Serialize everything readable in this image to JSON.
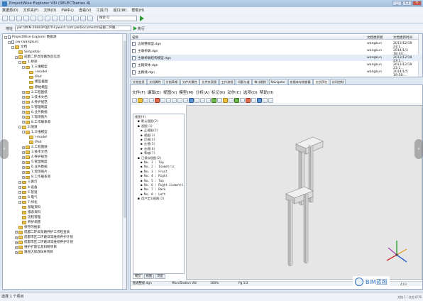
{
  "window": {
    "title": "ProjectWise Explorer V8i (SELECTseries 4)"
  },
  "menu": [
    "数据源(D)",
    "文件夹(F)",
    "文档(D)",
    "PW中心",
    "查看(V)",
    "工具(T)",
    "窗口(W)",
    "帮助(H)"
  ],
  "toolbar": {
    "search_value": "搜索 Q"
  },
  "address": {
    "label": "地址",
    "value": "pw:\\\\WIN-20883PQJOTH.pwsr4.com:pw\\Documents\\成都二环路...",
    "go_label": "执行"
  },
  "tree": [
    {
      "indent": 0,
      "exp": "-",
      "icon": "doc",
      "label": "ProjectWise Explorer 数据源"
    },
    {
      "indent": 1,
      "exp": "-",
      "icon": "doc",
      "label": "pw (wangkun)"
    },
    {
      "indent": 2,
      "exp": "-",
      "icon": "folder",
      "label": "文档"
    },
    {
      "indent": 3,
      "exp": "",
      "icon": "folder",
      "label": "Simplefair"
    },
    {
      "indent": 3,
      "exp": "-",
      "icon": "folder",
      "label": "成都二环高架路改造信息"
    },
    {
      "indent": 4,
      "exp": "-",
      "icon": "folder",
      "label": "1.桥梁"
    },
    {
      "indent": 5,
      "exp": "-",
      "icon": "folder",
      "label": "1.三维模型"
    },
    {
      "indent": 6,
      "exp": "",
      "icon": "folder",
      "label": "i-model"
    },
    {
      "indent": 6,
      "exp": "",
      "icon": "folder",
      "label": "iPad"
    },
    {
      "indent": 6,
      "exp": "",
      "icon": "folder",
      "label": "模型截图"
    },
    {
      "indent": 6,
      "exp": "",
      "icon": "folder",
      "label": "原始模型"
    },
    {
      "indent": 5,
      "exp": "+",
      "icon": "folder",
      "label": "2.工程图纸"
    },
    {
      "indent": 5,
      "exp": "+",
      "icon": "folder",
      "label": "3.技术文档"
    },
    {
      "indent": 5,
      "exp": "+",
      "icon": "folder",
      "label": "4.养护规范"
    },
    {
      "indent": 5,
      "exp": "+",
      "icon": "folder",
      "label": "5.管理制度"
    },
    {
      "indent": 5,
      "exp": "+",
      "icon": "folder",
      "label": "6.业务数据"
    },
    {
      "indent": 5,
      "exp": "+",
      "icon": "folder",
      "label": "7.现场照片"
    },
    {
      "indent": 5,
      "exp": "+",
      "icon": "folder",
      "label": "8.工作联系单"
    },
    {
      "indent": 4,
      "exp": "-",
      "icon": "folder",
      "label": "2.隧道"
    },
    {
      "indent": 5,
      "exp": "-",
      "icon": "folder",
      "label": "1.三维模型"
    },
    {
      "indent": 6,
      "exp": "",
      "icon": "folder",
      "label": "i-model"
    },
    {
      "indent": 6,
      "exp": "",
      "icon": "folder",
      "label": "iPad"
    },
    {
      "indent": 5,
      "exp": "+",
      "icon": "folder",
      "label": "2.工程图纸"
    },
    {
      "indent": 5,
      "exp": "+",
      "icon": "folder",
      "label": "3.技术文档"
    },
    {
      "indent": 5,
      "exp": "+",
      "icon": "folder",
      "label": "4.养护规范"
    },
    {
      "indent": 5,
      "exp": "+",
      "icon": "folder",
      "label": "5.管理制度"
    },
    {
      "indent": 5,
      "exp": "+",
      "icon": "folder",
      "label": "6.业务数据"
    },
    {
      "indent": 5,
      "exp": "+",
      "icon": "folder",
      "label": "7.现场照片"
    },
    {
      "indent": 5,
      "exp": "+",
      "icon": "folder",
      "label": "8.工作联系单"
    },
    {
      "indent": 4,
      "exp": "+",
      "icon": "folder",
      "label": "3.路灯"
    },
    {
      "indent": 4,
      "exp": "+",
      "icon": "folder",
      "label": "4.设备"
    },
    {
      "indent": 4,
      "exp": "+",
      "icon": "folder",
      "label": "5.管道"
    },
    {
      "indent": 4,
      "exp": "+",
      "icon": "folder",
      "label": "6.电气"
    },
    {
      "indent": 4,
      "exp": "+",
      "icon": "folder",
      "label": "7.绿化"
    },
    {
      "indent": 4,
      "exp": "",
      "icon": "folder",
      "label": "基础资料"
    },
    {
      "indent": 4,
      "exp": "",
      "icon": "folder",
      "label": "报表资料"
    },
    {
      "indent": 4,
      "exp": "",
      "icon": "folder",
      "label": "流程管理"
    },
    {
      "indent": 4,
      "exp": "",
      "icon": "folder",
      "label": "养护病害"
    },
    {
      "indent": 3,
      "exp": "",
      "icon": "folder",
      "label": "保存的搜索"
    },
    {
      "indent": 3,
      "exp": "+",
      "icon": "folder",
      "label": "成都二环高架路养护工作检查表"
    },
    {
      "indent": 3,
      "exp": "+",
      "icon": "folder",
      "label": "成都市区二环路日常维修养护计划"
    },
    {
      "indent": 3,
      "exp": "+",
      "icon": "folder",
      "label": "成都市区二环路日常维修养护计划"
    },
    {
      "indent": 3,
      "exp": "+",
      "icon": "folder",
      "label": "维护扩建信息科研项目"
    },
    {
      "indent": 3,
      "exp": "+",
      "icon": "folder",
      "label": "隧道大修改BIM项目"
    }
  ],
  "filelist": {
    "headers": [
      "名称",
      "文档更新者",
      "文档更新时间"
    ],
    "rows": [
      {
        "name": "边坡整模型.dgn",
        "user": "wangkun",
        "time": "2013/12/19 23:1..."
      },
      {
        "name": "主墩桥墩.dgn",
        "user": "wangkun",
        "time": "2014/1/3 18:44:..."
      },
      {
        "name": "主墩桥墩结构模型.dgn",
        "user": "wangkun",
        "time": "2013/12/19 23:1...",
        "selected": true
      },
      {
        "name": "主箱梁体.dgn",
        "user": "wangkun",
        "time": "2013/12/19 23:1..."
      },
      {
        "name": "主路线.dgn",
        "user": "wangkun",
        "time": "2014/1/5 19:58:..."
      }
    ]
  },
  "tabs": [
    "文档信息",
    "文档属性",
    "文档表格",
    "文件夹属性",
    "文件夹表格",
    "工作流程",
    "问题与道",
    "审计跟踪",
    "Navigator",
    "各版本存储查看",
    "文档预览",
    "访问控制"
  ],
  "active_tab_index": 10,
  "viewer": {
    "menu": [
      "文件(F)",
      "编辑(E)",
      "视图(V)",
      "模型(M)",
      "分析(A)",
      "标记(K)",
      "动作(C)",
      "选项(O)",
      "帮助(H)"
    ],
    "model_tree": [
      {
        "indent": 0,
        "label": "视图(V)"
      },
      {
        "indent": 1,
        "label": "■ 默认视图(2)"
      },
      {
        "indent": 1,
        "label": "■ 视图(1)"
      },
      {
        "indent": 2,
        "label": "● 正视图(2)"
      },
      {
        "indent": 2,
        "label": "● 视图(3)"
      },
      {
        "indent": 2,
        "label": "● 后视(4)"
      },
      {
        "indent": 2,
        "label": "● 左视(5)"
      },
      {
        "indent": 2,
        "label": "● 右视(6)"
      },
      {
        "indent": 2,
        "label": "● 等轴(7)"
      },
      {
        "indent": 1,
        "label": "■ 已保存视图(2)"
      },
      {
        "indent": 2,
        "label": "● No. 1 : Top"
      },
      {
        "indent": 2,
        "label": "● No. 2 : Isometric"
      },
      {
        "indent": 2,
        "label": "● No. 3 : Front"
      },
      {
        "indent": 2,
        "label": "● No. 4 : Right"
      },
      {
        "indent": 2,
        "label": "● No. 5 : Top"
      },
      {
        "indent": 2,
        "label": "● No. 6 : Right Isometric"
      },
      {
        "indent": 2,
        "label": "● No. 7 : Back"
      },
      {
        "indent": 2,
        "label": "● No. 8 : Left"
      },
      {
        "indent": 1,
        "label": "■ 用户定义视图(2)"
      }
    ],
    "bottom_tabs": [
      "模型",
      "视图",
      "浏览"
    ],
    "status": [
      "图通整视.dgn",
      "MicroStation V8i",
      "100%",
      "Pg 1/2"
    ]
  },
  "statusbar": {
    "text": "选择 1 个项目"
  },
  "watermark": {
    "text": "BIM蓝图"
  },
  "corner": {
    "coords": "4:03",
    "file": "文档 1 / 文档 6/76"
  }
}
